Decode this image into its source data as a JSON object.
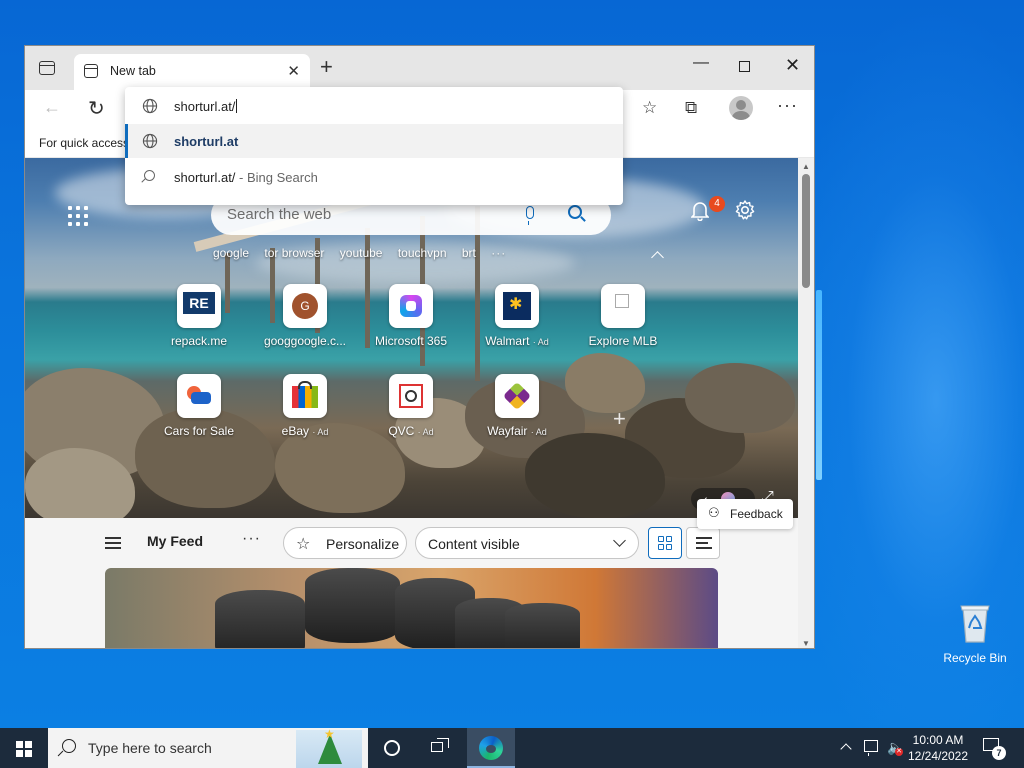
{
  "browser": {
    "tab_title": "New tab",
    "favorites_bar_text": "For quick access",
    "omnibox": {
      "input_value": "shorturl.at/",
      "suggestions": [
        {
          "text": "shorturl.at",
          "icon": "globe-icon"
        },
        {
          "text": "shorturl.at/",
          "suffix": "- Bing Search",
          "icon": "search-icon"
        }
      ]
    }
  },
  "newtab": {
    "search_placeholder": "Search the web",
    "notification_count": "4",
    "quick_links": [
      "google",
      "tor browser",
      "youtube",
      "touchvpn",
      "brt"
    ],
    "quick_links_more": "···",
    "tiles_row1": [
      {
        "label": "repack.me",
        "ad": ""
      },
      {
        "label": "googgoogle.c...",
        "ad": ""
      },
      {
        "label": "Microsoft 365",
        "ad": ""
      },
      {
        "label": "Walmart",
        "ad": "· Ad"
      },
      {
        "label": "Explore MLB",
        "ad": ""
      }
    ],
    "tiles_row2": [
      {
        "label": "Cars for Sale",
        "ad": ""
      },
      {
        "label": "eBay",
        "ad": "· Ad"
      },
      {
        "label": "QVC",
        "ad": "· Ad"
      },
      {
        "label": "Wayfair",
        "ad": "· Ad"
      }
    ],
    "tile_text": {
      "repack": "RE",
      "google_letter": "G"
    },
    "feed": {
      "title": "My Feed",
      "more": "···",
      "personalize": "Personalize",
      "content_visible": "Content visible"
    },
    "feedback": "Feedback"
  },
  "desktop": {
    "recycle_bin": "Recycle Bin"
  },
  "taskbar": {
    "search_placeholder": "Type here to search",
    "time": "10:00 AM",
    "date": "12/24/2022",
    "notification_count": "7"
  },
  "colors": {
    "accent": "#0f6cbd",
    "badge": "#e84a1e",
    "taskbar": "#1c2b3c"
  }
}
